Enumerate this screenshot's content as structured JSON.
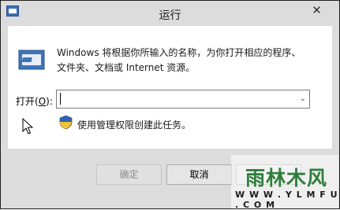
{
  "window": {
    "title": "运行",
    "close_glyph": "✕"
  },
  "description": [
    "Windows 将根据你所输入的名称，为你打开相应的程序、",
    "文件夹、文档或 Internet 资源。"
  ],
  "open": {
    "label_prefix": "打开(",
    "label_accesskey": "O",
    "label_suffix": "):",
    "value": ""
  },
  "admin_note": "使用管理权限创建此任务。",
  "buttons": {
    "ok": "确定",
    "cancel": "取消",
    "browse": ""
  },
  "watermark": {
    "main": "雨林木风",
    "sub": "W W W . Y L M F U . C O M"
  },
  "icons": {
    "system": "run-app-icon",
    "run": "run-dialog-icon",
    "shield": "uac-shield-icon",
    "cursor": "mouse-pointer-icon",
    "dropdown": "chevron-down-icon"
  },
  "colors": {
    "window_bg": "#dcdcdc",
    "content_bg": "#ffffff",
    "watermark_green": "#2e7d3a"
  }
}
